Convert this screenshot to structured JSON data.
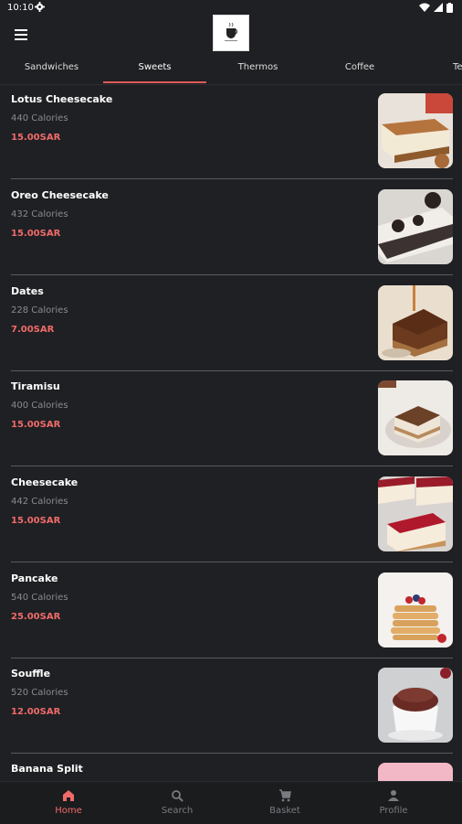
{
  "status": {
    "time": "10:10"
  },
  "tabs": [
    {
      "label": "Sandwiches"
    },
    {
      "label": "Sweets"
    },
    {
      "label": "Thermos"
    },
    {
      "label": "Coffee"
    },
    {
      "label": "Te"
    }
  ],
  "items": [
    {
      "name": "Lotus Cheesecake",
      "calories": "440 Calories",
      "price": "15.00SAR",
      "image": "lotus-cheesecake"
    },
    {
      "name": "Oreo Cheesecake",
      "calories": "432 Calories",
      "price": "15.00SAR",
      "image": "oreo-cheesecake"
    },
    {
      "name": "Dates",
      "calories": "228 Calories",
      "price": "7.00SAR",
      "image": "dates-cake"
    },
    {
      "name": "Tiramisu",
      "calories": "400 Calories",
      "price": "15.00SAR",
      "image": "tiramisu"
    },
    {
      "name": "Cheesecake",
      "calories": "442 Calories",
      "price": "15.00SAR",
      "image": "berry-cheesecake"
    },
    {
      "name": "Pancake",
      "calories": "540 Calories",
      "price": "25.00SAR",
      "image": "pancakes"
    },
    {
      "name": "Souffle",
      "calories": "520 Calories",
      "price": "12.00SAR",
      "image": "souffle"
    },
    {
      "name": "Banana Split",
      "calories": "",
      "price": "",
      "image": "banana-split"
    }
  ],
  "bottom_nav": [
    {
      "label": "Home",
      "icon": "home-icon",
      "active": true
    },
    {
      "label": "Search",
      "icon": "search-icon",
      "active": false
    },
    {
      "label": "Basket",
      "icon": "cart-icon",
      "active": false
    },
    {
      "label": "Profile",
      "icon": "profile-icon",
      "active": false
    }
  ],
  "colors": {
    "accent": "#f06a6a",
    "background": "#1f2023",
    "muted": "#8a8b8f"
  }
}
